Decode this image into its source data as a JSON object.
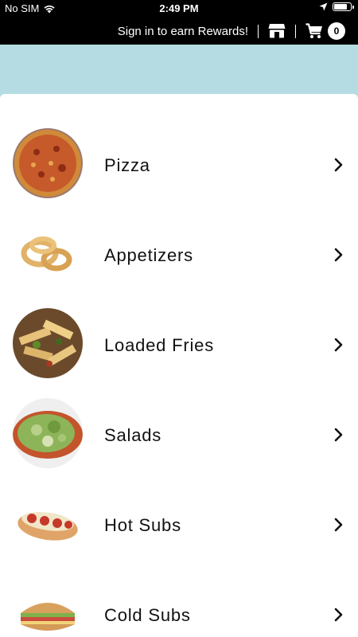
{
  "status_bar": {
    "carrier": "No SIM",
    "time": "2:49 PM",
    "battery_level": 0.85
  },
  "header": {
    "rewards_label": "Sign in to earn Rewards!",
    "cart_count": "0"
  },
  "colors": {
    "banner": "#b6dce3",
    "header_bg": "#000000"
  },
  "menu": [
    {
      "label": "Pizza",
      "icon": "pizza-icon"
    },
    {
      "label": "Appetizers",
      "icon": "onion-rings-icon"
    },
    {
      "label": "Loaded Fries",
      "icon": "loaded-fries-icon"
    },
    {
      "label": "Salads",
      "icon": "salad-icon"
    },
    {
      "label": "Hot Subs",
      "icon": "hot-sub-icon"
    },
    {
      "label": "Cold Subs",
      "icon": "cold-sub-icon"
    }
  ]
}
